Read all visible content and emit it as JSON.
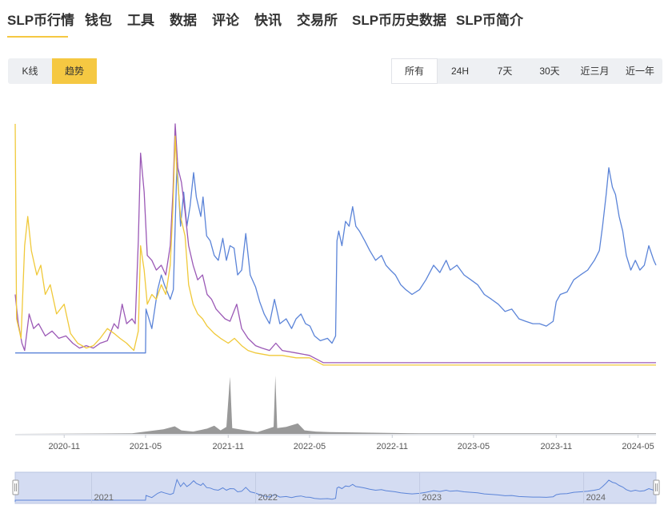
{
  "nav": {
    "tabs": [
      {
        "label": "SLP币行情",
        "active": true
      },
      {
        "label": "钱包",
        "active": false
      },
      {
        "label": "工具",
        "active": false
      },
      {
        "label": "数据",
        "active": false
      },
      {
        "label": "评论",
        "active": false
      },
      {
        "label": "快讯",
        "active": false
      },
      {
        "label": "交易所",
        "active": false
      },
      {
        "label": "SLP币历史数据",
        "active": false
      },
      {
        "label": "SLP币简介",
        "active": false
      }
    ],
    "accent_color": "#f5c842"
  },
  "view_toggle": {
    "options": [
      {
        "label": "K线",
        "active": false
      },
      {
        "label": "趋势",
        "active": true
      }
    ]
  },
  "range_selector": {
    "options": [
      {
        "label": "所有",
        "active": true
      },
      {
        "label": "24H",
        "active": false
      },
      {
        "label": "7天",
        "active": false
      },
      {
        "label": "30天",
        "active": false
      },
      {
        "label": "近三月",
        "active": false
      },
      {
        "label": "近一年",
        "active": false
      }
    ]
  },
  "chart_data": {
    "type": "line",
    "x_range": [
      "2020-07-15",
      "2024-06-10"
    ],
    "xticks": [
      "2020-11",
      "2021-05",
      "2021-11",
      "2022-05",
      "2022-11",
      "2023-05",
      "2023-11",
      "2024-05"
    ],
    "y_axis_labels": false,
    "grid": false,
    "legend": "none",
    "series": [
      {
        "color": "#5b84d8",
        "points": [
          [
            "2020-07-15",
            0.06
          ],
          [
            "2021-05-01",
            0.06
          ],
          [
            "2021-05-02",
            0.24
          ],
          [
            "2021-05-15",
            0.16
          ],
          [
            "2021-05-28",
            0.32
          ],
          [
            "2021-06-05",
            0.38
          ],
          [
            "2021-06-12",
            0.34
          ],
          [
            "2021-06-25",
            0.28
          ],
          [
            "2021-07-02",
            0.32
          ],
          [
            "2021-07-10",
            0.84
          ],
          [
            "2021-07-18",
            0.58
          ],
          [
            "2021-07-25",
            0.72
          ],
          [
            "2021-08-01",
            0.58
          ],
          [
            "2021-08-08",
            0.66
          ],
          [
            "2021-08-16",
            0.8
          ],
          [
            "2021-08-22",
            0.7
          ],
          [
            "2021-09-01",
            0.62
          ],
          [
            "2021-09-06",
            0.7
          ],
          [
            "2021-09-14",
            0.54
          ],
          [
            "2021-09-22",
            0.52
          ],
          [
            "2021-10-01",
            0.46
          ],
          [
            "2021-10-10",
            0.44
          ],
          [
            "2021-10-20",
            0.53
          ],
          [
            "2021-10-28",
            0.44
          ],
          [
            "2021-11-05",
            0.5
          ],
          [
            "2021-11-14",
            0.49
          ],
          [
            "2021-11-22",
            0.38
          ],
          [
            "2021-12-01",
            0.4
          ],
          [
            "2021-12-10",
            0.55
          ],
          [
            "2021-12-20",
            0.38
          ],
          [
            "2022-01-01",
            0.33
          ],
          [
            "2022-01-10",
            0.27
          ],
          [
            "2022-01-20",
            0.22
          ],
          [
            "2022-02-01",
            0.18
          ],
          [
            "2022-02-12",
            0.28
          ],
          [
            "2022-02-24",
            0.18
          ],
          [
            "2022-03-10",
            0.2
          ],
          [
            "2022-03-22",
            0.16
          ],
          [
            "2022-04-01",
            0.2
          ],
          [
            "2022-04-12",
            0.22
          ],
          [
            "2022-04-22",
            0.18
          ],
          [
            "2022-05-02",
            0.17
          ],
          [
            "2022-05-12",
            0.13
          ],
          [
            "2022-05-25",
            0.11
          ],
          [
            "2022-06-10",
            0.12
          ],
          [
            "2022-06-20",
            0.1
          ],
          [
            "2022-06-28",
            0.13
          ],
          [
            "2022-07-01",
            0.52
          ],
          [
            "2022-07-05",
            0.56
          ],
          [
            "2022-07-12",
            0.5
          ],
          [
            "2022-07-20",
            0.6
          ],
          [
            "2022-07-28",
            0.58
          ],
          [
            "2022-08-05",
            0.66
          ],
          [
            "2022-08-12",
            0.58
          ],
          [
            "2022-08-20",
            0.56
          ],
          [
            "2022-09-01",
            0.52
          ],
          [
            "2022-09-12",
            0.48
          ],
          [
            "2022-09-25",
            0.44
          ],
          [
            "2022-10-08",
            0.46
          ],
          [
            "2022-10-18",
            0.42
          ],
          [
            "2022-10-28",
            0.4
          ],
          [
            "2022-11-08",
            0.38
          ],
          [
            "2022-11-20",
            0.34
          ],
          [
            "2022-12-01",
            0.32
          ],
          [
            "2022-12-15",
            0.3
          ],
          [
            "2023-01-01",
            0.32
          ],
          [
            "2023-01-15",
            0.36
          ],
          [
            "2023-02-01",
            0.42
          ],
          [
            "2023-02-15",
            0.39
          ],
          [
            "2023-03-01",
            0.44
          ],
          [
            "2023-03-10",
            0.4
          ],
          [
            "2023-03-25",
            0.42
          ],
          [
            "2023-04-10",
            0.38
          ],
          [
            "2023-04-25",
            0.36
          ],
          [
            "2023-05-10",
            0.34
          ],
          [
            "2023-05-25",
            0.3
          ],
          [
            "2023-06-10",
            0.28
          ],
          [
            "2023-06-25",
            0.26
          ],
          [
            "2023-07-10",
            0.23
          ],
          [
            "2023-07-25",
            0.24
          ],
          [
            "2023-08-10",
            0.2
          ],
          [
            "2023-08-25",
            0.19
          ],
          [
            "2023-09-10",
            0.18
          ],
          [
            "2023-09-25",
            0.18
          ],
          [
            "2023-10-10",
            0.17
          ],
          [
            "2023-10-25",
            0.19
          ],
          [
            "2023-11-01",
            0.27
          ],
          [
            "2023-11-10",
            0.3
          ],
          [
            "2023-11-25",
            0.31
          ],
          [
            "2023-12-10",
            0.36
          ],
          [
            "2023-12-25",
            0.38
          ],
          [
            "2024-01-10",
            0.4
          ],
          [
            "2024-01-25",
            0.44
          ],
          [
            "2024-02-05",
            0.48
          ],
          [
            "2024-02-12",
            0.58
          ],
          [
            "2024-02-20",
            0.71
          ],
          [
            "2024-02-26",
            0.82
          ],
          [
            "2024-03-05",
            0.74
          ],
          [
            "2024-03-12",
            0.71
          ],
          [
            "2024-03-20",
            0.62
          ],
          [
            "2024-03-28",
            0.56
          ],
          [
            "2024-04-05",
            0.46
          ],
          [
            "2024-04-15",
            0.4
          ],
          [
            "2024-04-25",
            0.44
          ],
          [
            "2024-05-05",
            0.4
          ],
          [
            "2024-05-15",
            0.42
          ],
          [
            "2024-05-25",
            0.5
          ],
          [
            "2024-06-05",
            0.44
          ],
          [
            "2024-06-10",
            0.42
          ]
        ]
      },
      {
        "color": "#9b59b6",
        "points": [
          [
            "2020-07-15",
            0.3
          ],
          [
            "2020-07-22",
            0.18
          ],
          [
            "2020-07-30",
            0.1
          ],
          [
            "2020-08-05",
            0.07
          ],
          [
            "2020-08-15",
            0.22
          ],
          [
            "2020-08-25",
            0.16
          ],
          [
            "2020-09-05",
            0.18
          ],
          [
            "2020-09-20",
            0.13
          ],
          [
            "2020-10-05",
            0.15
          ],
          [
            "2020-10-20",
            0.12
          ],
          [
            "2020-11-05",
            0.13
          ],
          [
            "2020-11-20",
            0.1
          ],
          [
            "2020-12-05",
            0.08
          ],
          [
            "2020-12-20",
            0.09
          ],
          [
            "2021-01-05",
            0.08
          ],
          [
            "2021-01-20",
            0.1
          ],
          [
            "2021-02-05",
            0.11
          ],
          [
            "2021-02-20",
            0.18
          ],
          [
            "2021-03-01",
            0.16
          ],
          [
            "2021-03-10",
            0.26
          ],
          [
            "2021-03-20",
            0.18
          ],
          [
            "2021-04-01",
            0.2
          ],
          [
            "2021-04-08",
            0.18
          ],
          [
            "2021-04-15",
            0.52
          ],
          [
            "2021-04-20",
            0.88
          ],
          [
            "2021-04-28",
            0.72
          ],
          [
            "2021-05-05",
            0.46
          ],
          [
            "2021-05-15",
            0.44
          ],
          [
            "2021-05-25",
            0.4
          ],
          [
            "2021-06-05",
            0.42
          ],
          [
            "2021-06-15",
            0.38
          ],
          [
            "2021-06-25",
            0.5
          ],
          [
            "2021-07-01",
            0.72
          ],
          [
            "2021-07-06",
            1.0
          ],
          [
            "2021-07-12",
            0.82
          ],
          [
            "2021-07-20",
            0.76
          ],
          [
            "2021-07-28",
            0.64
          ],
          [
            "2021-08-05",
            0.5
          ],
          [
            "2021-08-15",
            0.42
          ],
          [
            "2021-08-25",
            0.36
          ],
          [
            "2021-09-05",
            0.38
          ],
          [
            "2021-09-15",
            0.3
          ],
          [
            "2021-09-25",
            0.28
          ],
          [
            "2021-10-05",
            0.24
          ],
          [
            "2021-10-15",
            0.22
          ],
          [
            "2021-10-25",
            0.2
          ],
          [
            "2021-11-05",
            0.19
          ],
          [
            "2021-11-20",
            0.26
          ],
          [
            "2021-12-01",
            0.16
          ],
          [
            "2021-12-15",
            0.12
          ],
          [
            "2022-01-01",
            0.09
          ],
          [
            "2022-01-15",
            0.08
          ],
          [
            "2022-02-01",
            0.07
          ],
          [
            "2022-02-15",
            0.1
          ],
          [
            "2022-03-01",
            0.07
          ],
          [
            "2022-04-01",
            0.06
          ],
          [
            "2022-05-01",
            0.05
          ],
          [
            "2022-06-01",
            0.02
          ],
          [
            "2023-01-01",
            0.02
          ],
          [
            "2024-01-01",
            0.02
          ],
          [
            "2024-06-10",
            0.02
          ]
        ]
      },
      {
        "color": "#f0c93a",
        "points": [
          [
            "2020-07-15",
            1.0
          ],
          [
            "2020-07-18",
            0.2
          ],
          [
            "2020-07-28",
            0.12
          ],
          [
            "2020-08-05",
            0.5
          ],
          [
            "2020-08-12",
            0.62
          ],
          [
            "2020-08-20",
            0.48
          ],
          [
            "2020-09-01",
            0.38
          ],
          [
            "2020-09-10",
            0.42
          ],
          [
            "2020-09-20",
            0.3
          ],
          [
            "2020-10-01",
            0.34
          ],
          [
            "2020-10-15",
            0.22
          ],
          [
            "2020-11-01",
            0.26
          ],
          [
            "2020-11-15",
            0.14
          ],
          [
            "2020-12-01",
            0.1
          ],
          [
            "2020-12-20",
            0.08
          ],
          [
            "2021-01-05",
            0.09
          ],
          [
            "2021-01-20",
            0.12
          ],
          [
            "2021-02-05",
            0.16
          ],
          [
            "2021-02-20",
            0.14
          ],
          [
            "2021-03-05",
            0.12
          ],
          [
            "2021-03-20",
            0.1
          ],
          [
            "2021-04-05",
            0.07
          ],
          [
            "2021-04-15",
            0.15
          ],
          [
            "2021-04-20",
            0.5
          ],
          [
            "2021-04-28",
            0.4
          ],
          [
            "2021-05-05",
            0.26
          ],
          [
            "2021-05-15",
            0.3
          ],
          [
            "2021-05-25",
            0.28
          ],
          [
            "2021-06-05",
            0.34
          ],
          [
            "2021-06-15",
            0.3
          ],
          [
            "2021-06-25",
            0.42
          ],
          [
            "2021-07-01",
            0.66
          ],
          [
            "2021-07-06",
            0.95
          ],
          [
            "2021-07-10",
            0.8
          ],
          [
            "2021-07-18",
            0.62
          ],
          [
            "2021-07-28",
            0.54
          ],
          [
            "2021-08-05",
            0.34
          ],
          [
            "2021-08-15",
            0.26
          ],
          [
            "2021-08-25",
            0.22
          ],
          [
            "2021-09-05",
            0.2
          ],
          [
            "2021-09-15",
            0.17
          ],
          [
            "2021-10-01",
            0.14
          ],
          [
            "2021-10-15",
            0.12
          ],
          [
            "2021-11-01",
            0.1
          ],
          [
            "2021-11-15",
            0.12
          ],
          [
            "2021-12-01",
            0.09
          ],
          [
            "2021-12-15",
            0.07
          ],
          [
            "2022-01-01",
            0.06
          ],
          [
            "2022-02-01",
            0.05
          ],
          [
            "2022-03-01",
            0.05
          ],
          [
            "2022-04-01",
            0.04
          ],
          [
            "2022-05-01",
            0.04
          ],
          [
            "2022-06-01",
            0.01
          ],
          [
            "2023-01-01",
            0.01
          ],
          [
            "2024-01-01",
            0.01
          ],
          [
            "2024-06-10",
            0.01
          ]
        ]
      }
    ],
    "volume": {
      "color": "#999999",
      "points": [
        [
          "2020-07-15",
          0.0
        ],
        [
          "2021-04-01",
          0.01
        ],
        [
          "2021-05-01",
          0.04
        ],
        [
          "2021-06-10",
          0.08
        ],
        [
          "2021-07-05",
          0.13
        ],
        [
          "2021-07-20",
          0.06
        ],
        [
          "2021-08-15",
          0.04
        ],
        [
          "2021-09-15",
          0.09
        ],
        [
          "2021-10-01",
          0.14
        ],
        [
          "2021-10-15",
          0.06
        ],
        [
          "2021-10-28",
          0.12
        ],
        [
          "2021-11-05",
          0.98
        ],
        [
          "2021-11-10",
          0.1
        ],
        [
          "2021-12-10",
          0.06
        ],
        [
          "2022-01-05",
          0.03
        ],
        [
          "2022-02-10",
          0.12
        ],
        [
          "2022-02-14",
          1.0
        ],
        [
          "2022-02-18",
          0.1
        ],
        [
          "2022-03-10",
          0.12
        ],
        [
          "2022-04-05",
          0.18
        ],
        [
          "2022-04-20",
          0.06
        ],
        [
          "2022-05-15",
          0.04
        ],
        [
          "2022-06-15",
          0.03
        ],
        [
          "2023-01-01",
          0.01
        ],
        [
          "2024-01-01",
          0.01
        ],
        [
          "2024-06-10",
          0.01
        ]
      ]
    },
    "navigator": {
      "labels": [
        "2021",
        "2022",
        "2023",
        "2024"
      ],
      "label_dates": [
        "2021-01-01",
        "2022-01-01",
        "2023-01-01",
        "2024-01-01"
      ]
    }
  }
}
